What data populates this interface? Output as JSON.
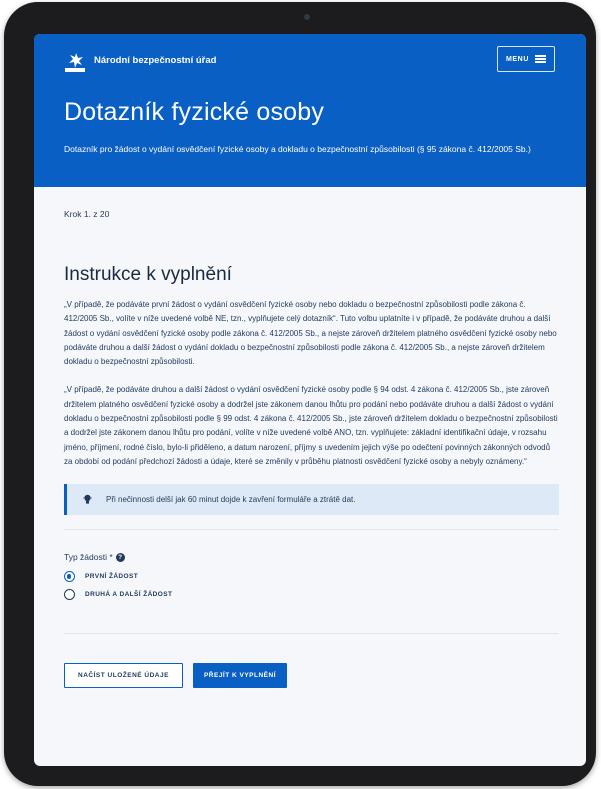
{
  "header": {
    "agency_name": "Národní bezpečnostní úřad",
    "logo_text": "NBÚ",
    "menu_label": "MENU",
    "title": "Dotazník fyzické osoby",
    "subtitle": "Dotazník pro žádost o vydání osvědčení fyzické osoby a dokladu o bezpečnostní způsobilosti (§ 95 zákona č. 412/2005 Sb.)"
  },
  "main": {
    "step": "Krok 1. z 20",
    "section_title": "Instrukce k vyplnění",
    "paragraphs": [
      "„V případě, že podáváte první žádost o vydání osvědčení fyzické osoby nebo dokladu o bezpečnostní způsobilosti podle zákona č. 412/2005 Sb., volíte v níže uvedené volbě NE, tzn., vyplňujete celý dotazník“. Tuto volbu uplatníte i v případě, že podáváte druhou a další žádost o vydání osvědčení fyzické osoby podle zákona č. 412/2005 Sb., a nejste zároveň držitelem platného osvědčení fyzické osoby nebo podáváte druhou a další žádost o vydání dokladu o bezpečnostní způsobilosti podle zákona č. 412/2005 Sb., a nejste zároveň držitelem dokladu o bezpečnostní způsobilosti.",
      "„V případě, že podáváte druhou a další žádost o vydání osvědčení fyzické osoby podle § 94 odst. 4 zákona č. 412/2005 Sb., jste zároveň držitelem platného osvědčení fyzické osoby a dodržel jste zákonem danou lhůtu pro podání nebo podáváte druhou a další žádost o vydání dokladu o bezpečnostní způsobilosti podle § 99 odst. 4 zákona č. 412/2005 Sb., jste zároveň držitelem dokladu o bezpečnostní způsobilosti a dodržel jste zákonem danou lhůtu pro podání, volíte v níže uvedené volbě ANO, tzn. vyplňujete: základní identifikační údaje, v rozsahu jméno, příjmení, rodné číslo, bylo-li přiděleno, a datum narození, příjmy s uvedením jejich výše po odečtení povinných zákonných odvodů za období od podání předchozí žádosti a údaje, které se změnily v průběhu platnosti osvědčení fyzické osoby a nebyly oznámeny.“"
    ],
    "notice": "Při nečinnosti delší jak 60 minut dojde k zavření formuláře a ztrátě dat.",
    "field_label": "Typ žádosti *",
    "options": [
      {
        "label": "PRVNÍ ŽÁDOST",
        "checked": true
      },
      {
        "label": "DRUHÁ A DALŠÍ ŽÁDOST",
        "checked": false
      }
    ],
    "buttons": {
      "load_saved": "NAČÍST ULOŽENÉ ÚDAJE",
      "proceed": "PŘEJÍT K VYPLNĚNÍ"
    }
  },
  "colors": {
    "brand": "#0a5fc4",
    "notice_bg": "#dde9f6",
    "text": "#1f3a5c"
  }
}
